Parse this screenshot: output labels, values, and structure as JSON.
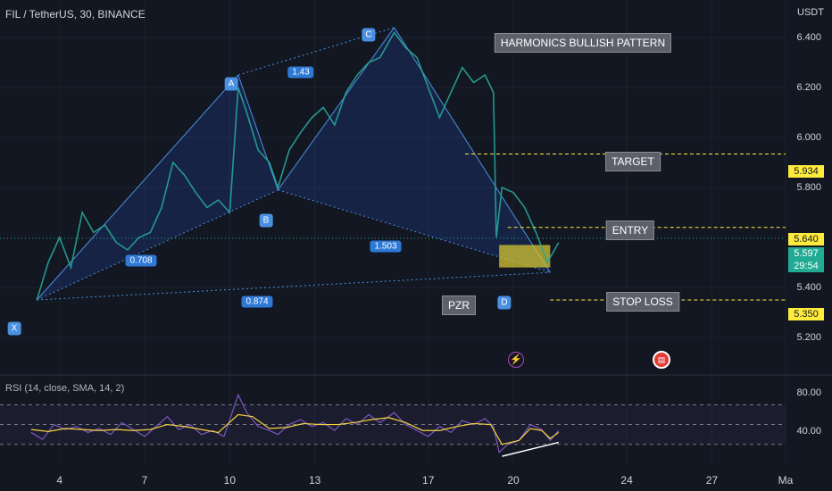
{
  "header": {
    "symbol_line": "FIL / TetherUS, 30, BINANCE",
    "currency": "USDT"
  },
  "rsi": {
    "title": "RSI (14, close, SMA, 14, 2)",
    "ticks": [
      "80.00",
      "40.00"
    ]
  },
  "colors": {
    "background": "#131722",
    "pattern_fill": "#2962ff",
    "pattern_line": "#4a90e2",
    "rsi_line": "#7e57c2",
    "rsi_sma": "#f5d33f",
    "guide_line": "#ffeb3b",
    "prz_fill": "#d4c533"
  },
  "annotations": {
    "title_box": "HARMONICS BULLISH PATTERN",
    "target_label": "TARGET",
    "entry_label": "ENTRY",
    "stop_label": "STOP LOSS",
    "prz_label": "PZR"
  },
  "points": {
    "x": "X",
    "a": "A",
    "b": "B",
    "c": "C",
    "d": "D"
  },
  "ratios": {
    "xb": "0.708",
    "ac": "1.43",
    "bd": "1.503",
    "xd": "0.874"
  },
  "price_tags": {
    "target": "5.934",
    "entry": "5.640",
    "current": "5.597",
    "countdown": "29:54",
    "stop": "5.350"
  },
  "icons": {
    "flash": "lightning-icon",
    "flag": "us-flag-icon"
  },
  "chart_data": {
    "type": "line",
    "title": "FIL / TetherUS, 30, BINANCE",
    "ylabel": "USDT",
    "ylim": [
      5.05,
      6.55
    ],
    "y_ticks": [
      "6.400",
      "6.200",
      "6.000",
      "5.800",
      "5.400",
      "5.200"
    ],
    "x_ticks": [
      "4",
      "7",
      "10",
      "13",
      "17",
      "20",
      "24",
      "27",
      "Ma"
    ],
    "pattern": [
      {
        "name": "X",
        "x": 3.2,
        "y": 5.35
      },
      {
        "name": "A",
        "x": 10.3,
        "y": 6.25
      },
      {
        "name": "B",
        "x": 11.7,
        "y": 5.79
      },
      {
        "name": "C",
        "x": 15.8,
        "y": 6.44
      },
      {
        "name": "D",
        "x": 21.3,
        "y": 5.46
      }
    ],
    "levels": {
      "target": 5.934,
      "entry": 5.64,
      "stop_loss": 5.35,
      "current": 5.597
    },
    "prz": {
      "x_from": 19.5,
      "x_to": 21.3,
      "y_from": 5.48,
      "y_to": 5.57
    },
    "price_path": [
      [
        3.2,
        5.35
      ],
      [
        3.6,
        5.5
      ],
      [
        4.0,
        5.6
      ],
      [
        4.4,
        5.48
      ],
      [
        4.8,
        5.7
      ],
      [
        5.2,
        5.62
      ],
      [
        5.6,
        5.65
      ],
      [
        6.0,
        5.58
      ],
      [
        6.4,
        5.55
      ],
      [
        6.8,
        5.6
      ],
      [
        7.2,
        5.62
      ],
      [
        7.6,
        5.72
      ],
      [
        8.0,
        5.9
      ],
      [
        8.4,
        5.85
      ],
      [
        8.8,
        5.78
      ],
      [
        9.2,
        5.72
      ],
      [
        9.6,
        5.75
      ],
      [
        10.0,
        5.7
      ],
      [
        10.3,
        6.2
      ],
      [
        10.6,
        6.1
      ],
      [
        11.0,
        5.95
      ],
      [
        11.4,
        5.9
      ],
      [
        11.7,
        5.8
      ],
      [
        12.1,
        5.95
      ],
      [
        12.5,
        6.02
      ],
      [
        12.9,
        6.08
      ],
      [
        13.3,
        6.12
      ],
      [
        13.7,
        6.05
      ],
      [
        14.1,
        6.18
      ],
      [
        14.5,
        6.25
      ],
      [
        14.9,
        6.3
      ],
      [
        15.3,
        6.32
      ],
      [
        15.8,
        6.42
      ],
      [
        16.2,
        6.36
      ],
      [
        16.6,
        6.32
      ],
      [
        17.0,
        6.2
      ],
      [
        17.4,
        6.08
      ],
      [
        17.8,
        6.18
      ],
      [
        18.2,
        6.28
      ],
      [
        18.6,
        6.22
      ],
      [
        19.0,
        6.25
      ],
      [
        19.3,
        6.18
      ],
      [
        19.4,
        5.6
      ],
      [
        19.6,
        5.8
      ],
      [
        20.0,
        5.78
      ],
      [
        20.4,
        5.72
      ],
      [
        20.8,
        5.62
      ],
      [
        21.2,
        5.5
      ],
      [
        21.6,
        5.58
      ]
    ],
    "rsi_ylim": [
      10,
      100
    ],
    "rsi_levels": [
      70,
      50,
      30
    ],
    "rsi_series": [
      [
        3.0,
        42
      ],
      [
        3.4,
        35
      ],
      [
        3.8,
        50
      ],
      [
        4.2,
        45
      ],
      [
        4.6,
        48
      ],
      [
        5.0,
        42
      ],
      [
        5.4,
        46
      ],
      [
        5.8,
        40
      ],
      [
        6.2,
        52
      ],
      [
        6.6,
        45
      ],
      [
        7.0,
        38
      ],
      [
        7.4,
        48
      ],
      [
        7.8,
        58
      ],
      [
        8.2,
        45
      ],
      [
        8.6,
        50
      ],
      [
        9.0,
        40
      ],
      [
        9.4,
        44
      ],
      [
        9.8,
        38
      ],
      [
        10.3,
        80
      ],
      [
        10.6,
        62
      ],
      [
        11.0,
        48
      ],
      [
        11.4,
        44
      ],
      [
        11.7,
        40
      ],
      [
        12.1,
        50
      ],
      [
        12.5,
        55
      ],
      [
        12.9,
        48
      ],
      [
        13.3,
        52
      ],
      [
        13.7,
        44
      ],
      [
        14.1,
        56
      ],
      [
        14.5,
        50
      ],
      [
        14.9,
        60
      ],
      [
        15.3,
        52
      ],
      [
        15.8,
        62
      ],
      [
        16.2,
        50
      ],
      [
        16.6,
        44
      ],
      [
        17.0,
        38
      ],
      [
        17.4,
        48
      ],
      [
        17.8,
        42
      ],
      [
        18.2,
        54
      ],
      [
        18.6,
        50
      ],
      [
        19.0,
        56
      ],
      [
        19.3,
        48
      ],
      [
        19.5,
        22
      ],
      [
        19.8,
        30
      ],
      [
        20.2,
        34
      ],
      [
        20.6,
        50
      ],
      [
        21.0,
        45
      ],
      [
        21.3,
        34
      ],
      [
        21.6,
        44
      ]
    ],
    "rsi_sma_series": [
      [
        3.0,
        45
      ],
      [
        3.6,
        43
      ],
      [
        4.2,
        46
      ],
      [
        4.8,
        45
      ],
      [
        5.4,
        44
      ],
      [
        6.0,
        45
      ],
      [
        6.6,
        44
      ],
      [
        7.2,
        45
      ],
      [
        7.8,
        50
      ],
      [
        8.4,
        48
      ],
      [
        9.0,
        45
      ],
      [
        9.6,
        42
      ],
      [
        10.3,
        60
      ],
      [
        10.8,
        58
      ],
      [
        11.4,
        46
      ],
      [
        12.0,
        47
      ],
      [
        12.6,
        51
      ],
      [
        13.2,
        50
      ],
      [
        13.8,
        50
      ],
      [
        14.4,
        52
      ],
      [
        15.0,
        55
      ],
      [
        15.6,
        57
      ],
      [
        16.2,
        52
      ],
      [
        16.8,
        44
      ],
      [
        17.4,
        44
      ],
      [
        18.0,
        48
      ],
      [
        18.6,
        51
      ],
      [
        19.2,
        50
      ],
      [
        19.6,
        30
      ],
      [
        20.2,
        34
      ],
      [
        20.6,
        46
      ],
      [
        21.0,
        44
      ],
      [
        21.3,
        36
      ],
      [
        21.6,
        42
      ]
    ]
  }
}
